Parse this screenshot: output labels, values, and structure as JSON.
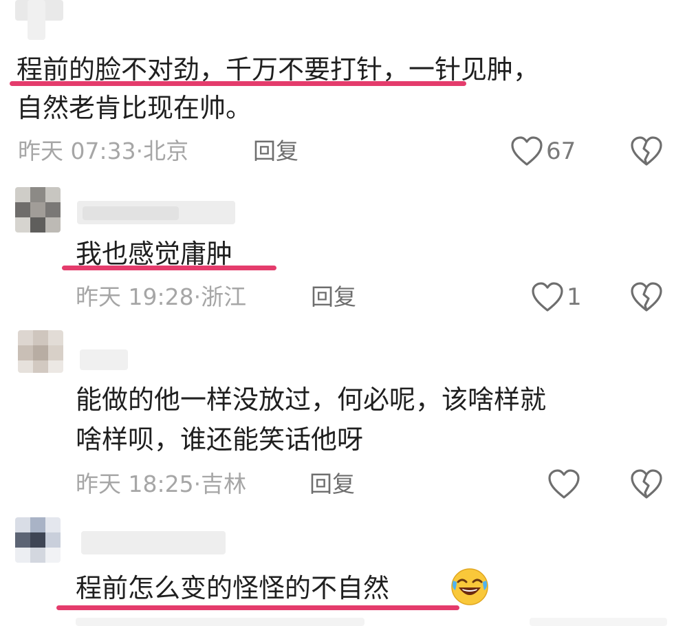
{
  "comments": [
    {
      "text_line1": "程前的脸不对劲，千万不要打针，一针见肿，",
      "text_line2": "自然老肯比现在帅。",
      "time": "昨天 07:33",
      "location": "北京",
      "reply_label": "回复",
      "likes": "67"
    },
    {
      "text_line1": "我也感觉庸肿",
      "time": "昨天 19:28",
      "location": "浙江",
      "reply_label": "回复",
      "likes": "1"
    },
    {
      "text_line1": "能做的他一样没放过，何必呢，该啥样就",
      "text_line2": "啥样呗，谁还能笑话他呀",
      "time": "昨天 18:25",
      "location": "吉林",
      "reply_label": "回复",
      "likes": ""
    },
    {
      "text_line1": "程前怎么变的怪怪的不自然",
      "emoji": "rolling-laughing-emoji"
    }
  ],
  "colors": {
    "highlight_underline": "#e43c6c",
    "meta_text": "#a6a6a6",
    "reply_text": "#6e6e6e"
  },
  "icons": {
    "like": "heart-outline-icon",
    "dislike": "broken-heart-icon"
  }
}
